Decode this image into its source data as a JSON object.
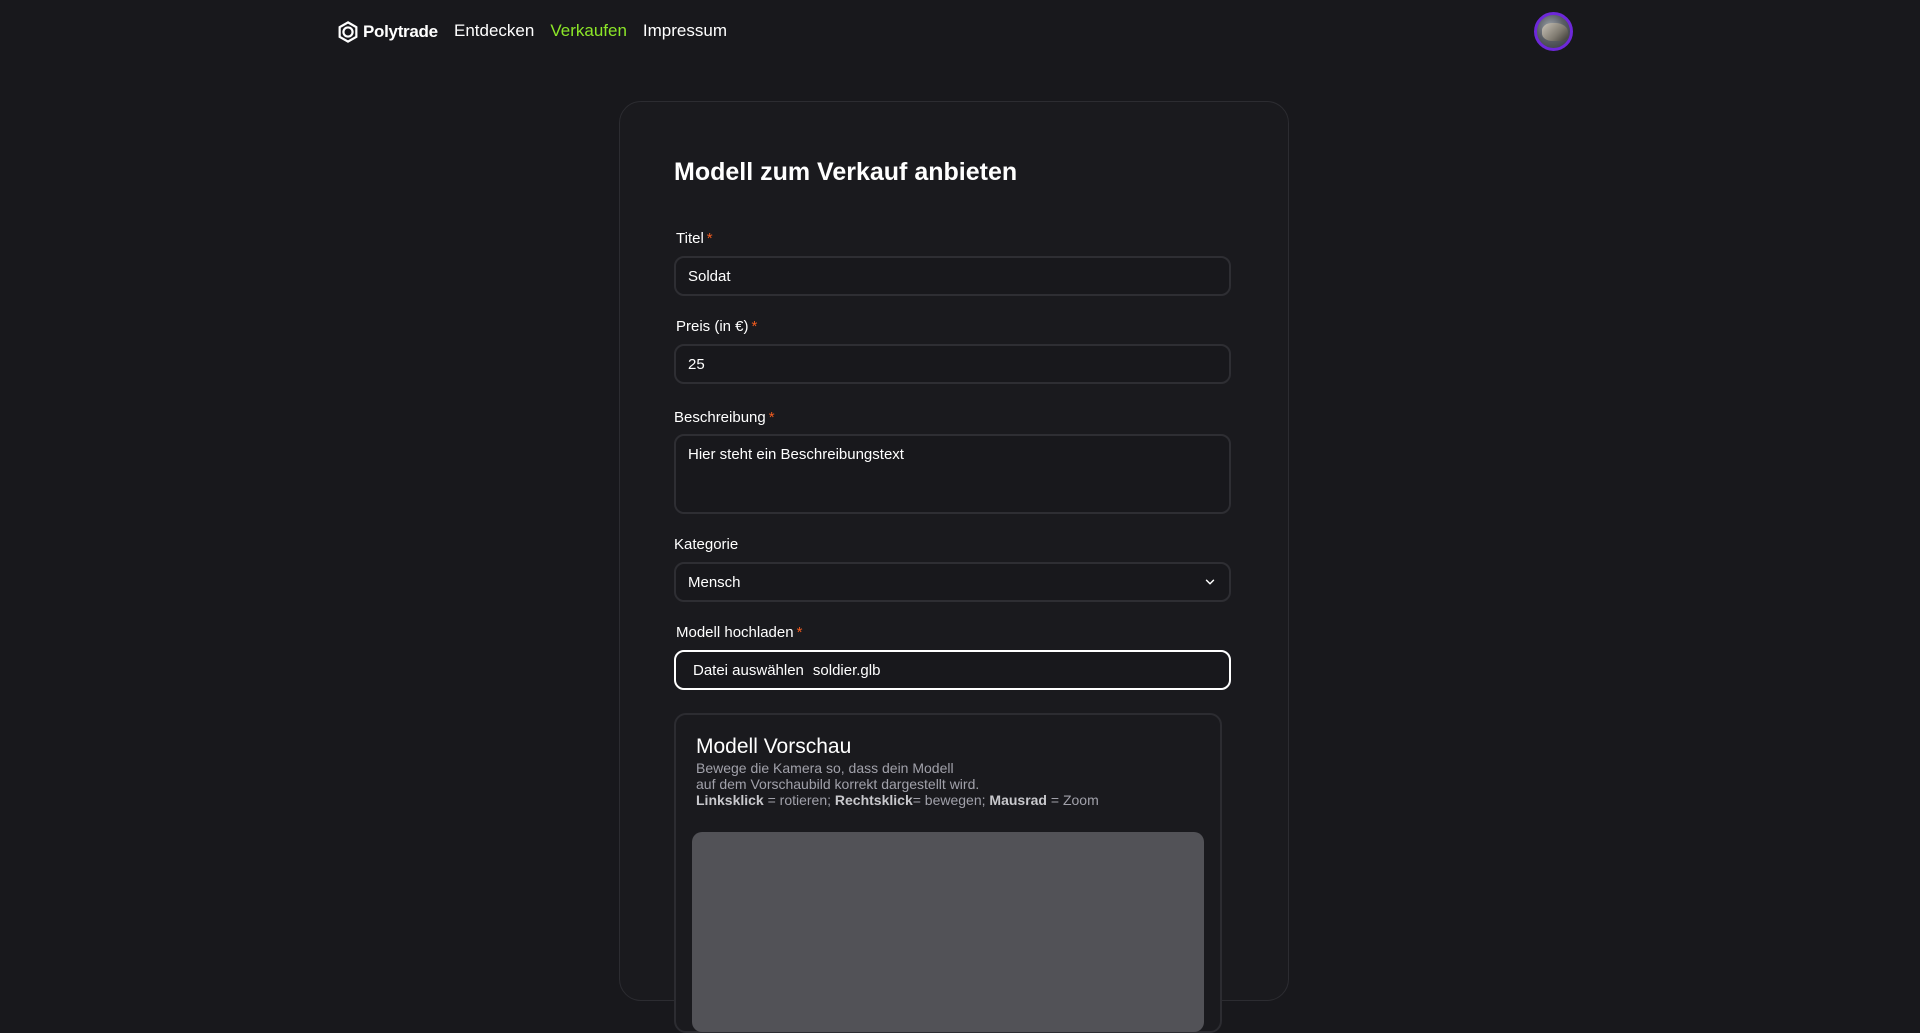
{
  "nav": {
    "brand": "Polytrade",
    "links": [
      {
        "label": "Entdecken"
      },
      {
        "label": "Verkaufen"
      },
      {
        "label": "Impressum"
      }
    ],
    "accent_color": "#8ce628"
  },
  "form": {
    "title": "Modell zum Verkauf anbieten",
    "required_mark": "*",
    "fields": {
      "titel": {
        "label": "Titel",
        "value": "Soldat"
      },
      "preis": {
        "label": "Preis (in €)",
        "value": "25"
      },
      "beschreibung": {
        "label": "Beschreibung",
        "value": "Hier steht ein Beschreibungstext"
      },
      "kategorie": {
        "label": "Kategorie",
        "value": "Mensch"
      },
      "upload": {
        "label": "Modell hochladen",
        "button": "Datei auswählen",
        "filename": "soldier.glb"
      }
    }
  },
  "preview": {
    "title": "Modell Vorschau",
    "line1": "Bewege die Kamera so, dass dein Modell",
    "line2": "auf dem Vorschaubild korrekt dargestellt wird.",
    "ctrl_left_key": "Linksklick",
    "ctrl_left_action": " = rotieren; ",
    "ctrl_right_key": "Rechtsklick",
    "ctrl_right_action": "= bewegen; ",
    "ctrl_wheel_key": "Mausrad",
    "ctrl_wheel_action": " = Zoom"
  },
  "colors": {
    "background": "#18181c",
    "required": "#f25c1f",
    "avatar_ring": "#6d28d9",
    "viewport": "#525257"
  },
  "icons": {
    "logo": "polytrade-logo-icon",
    "select": "chevron-down-icon"
  }
}
